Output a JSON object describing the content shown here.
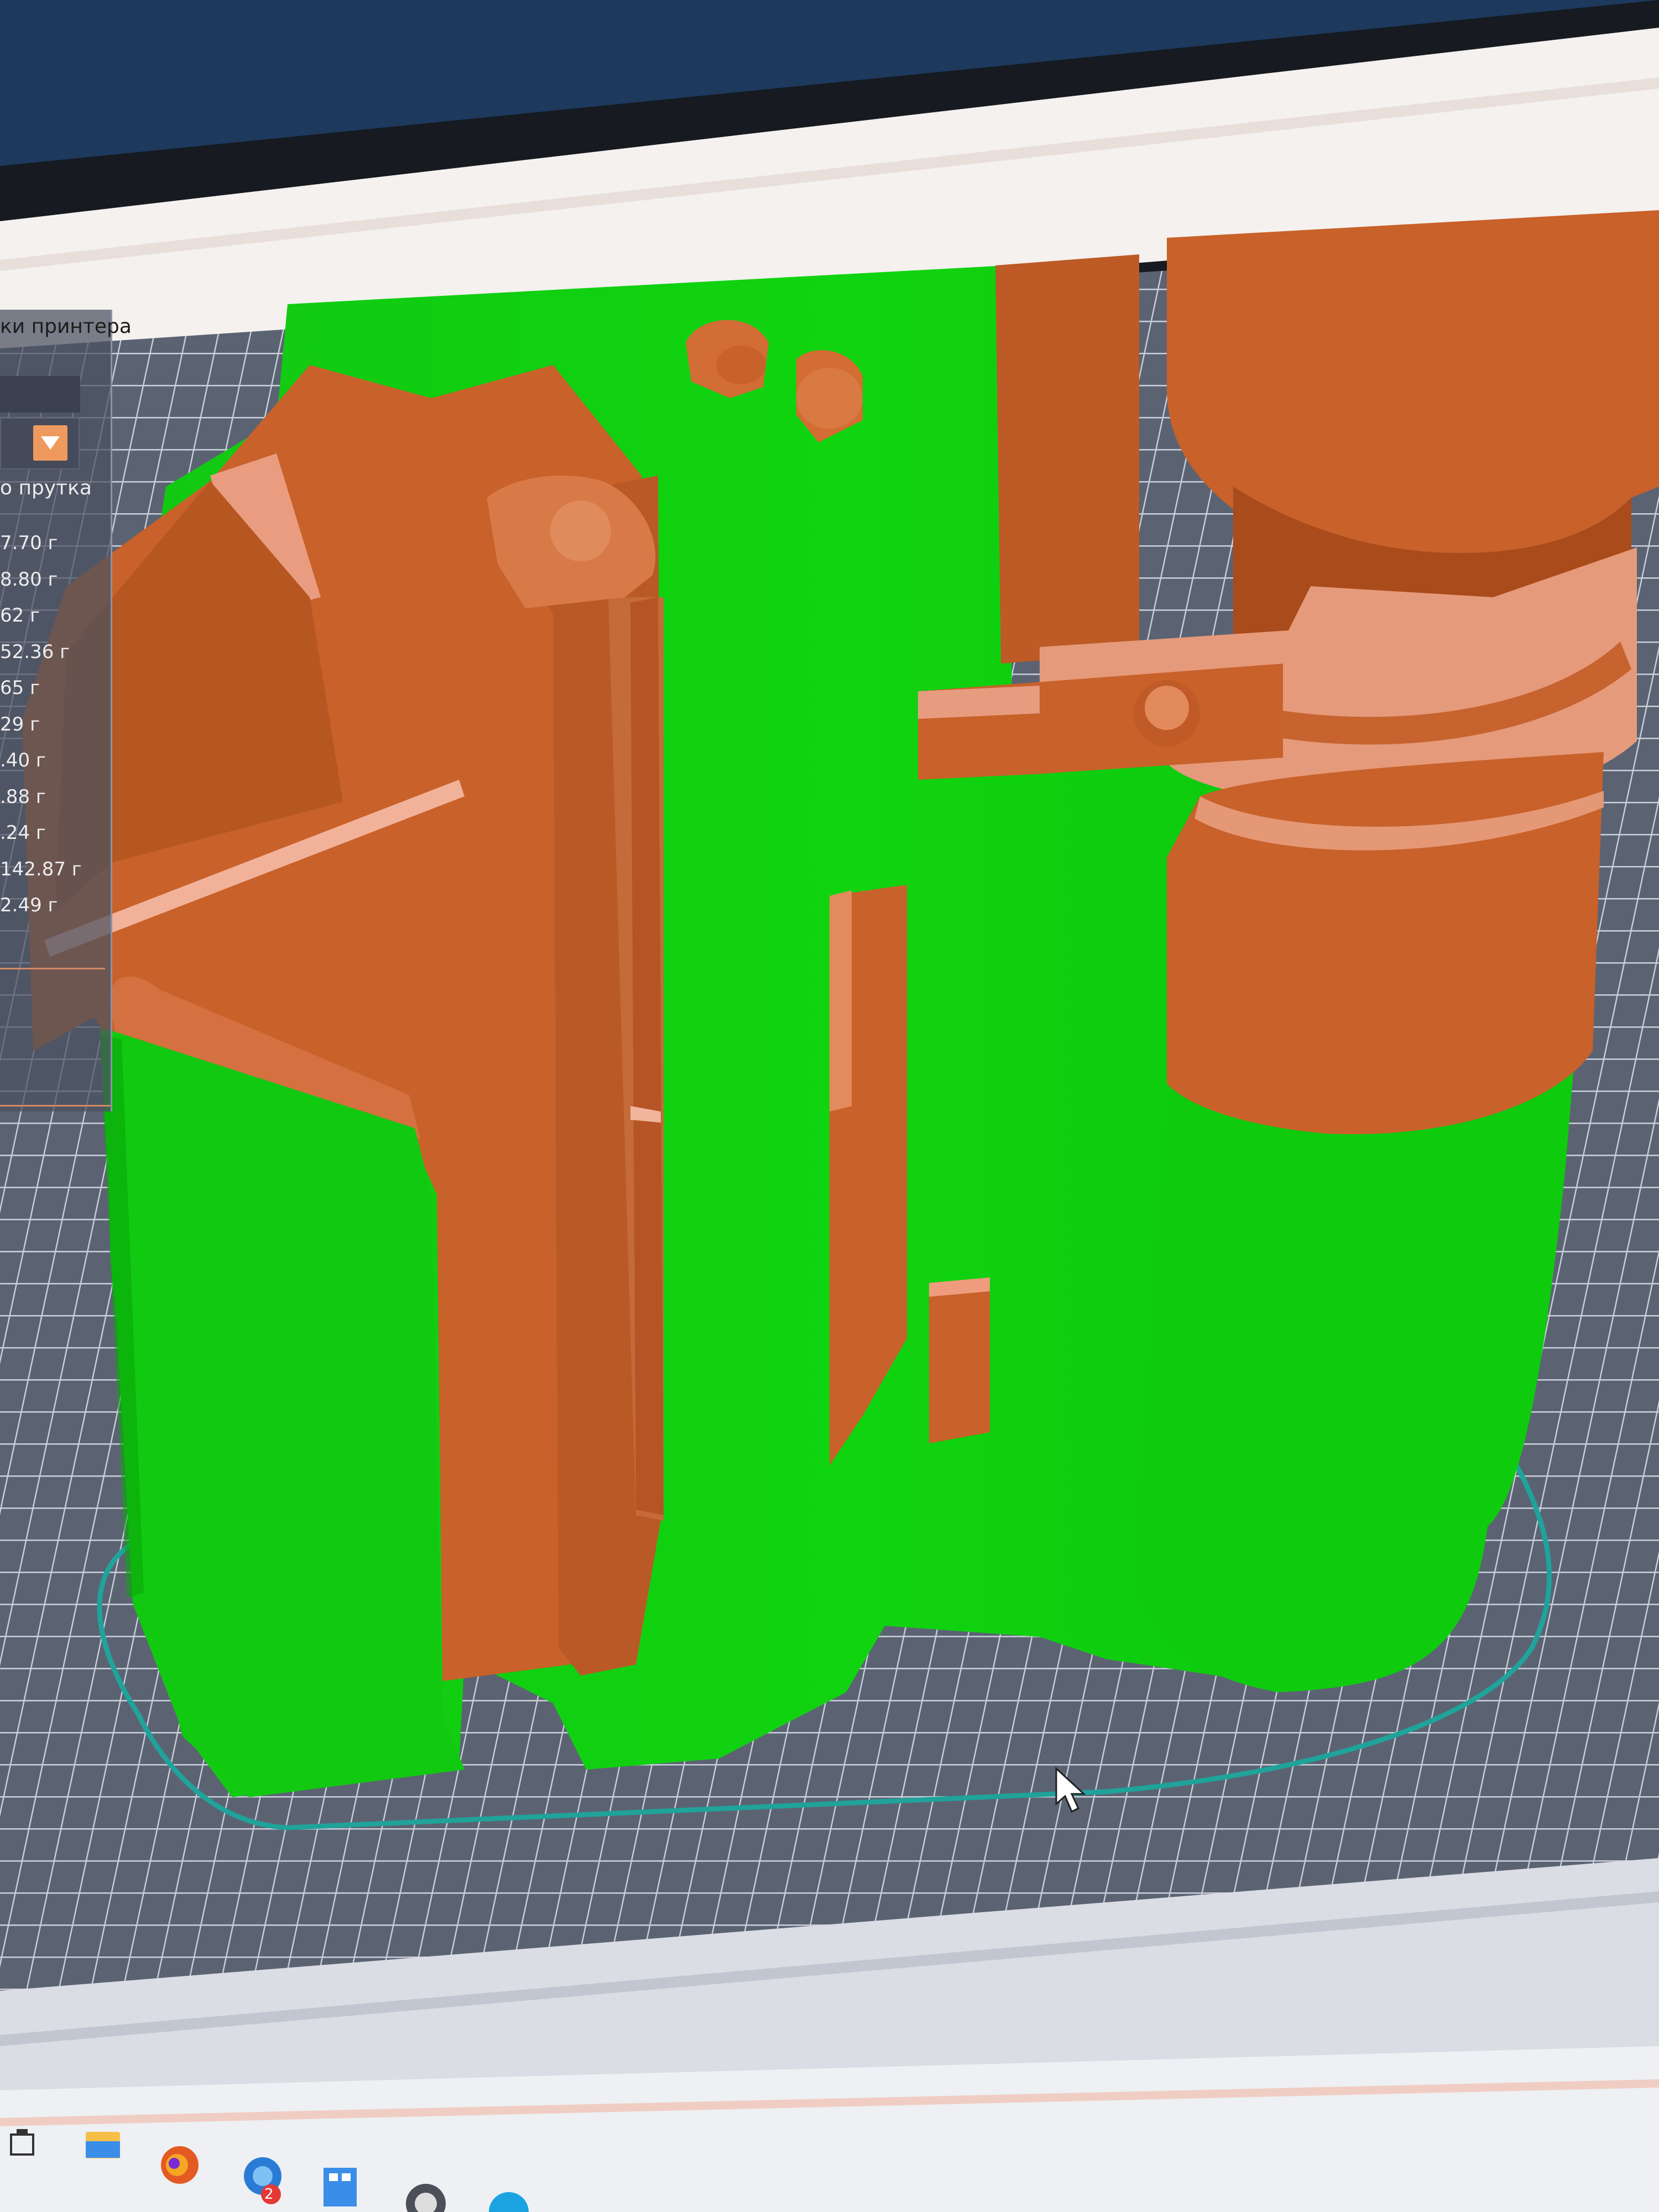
{
  "window": {
    "menu_title": "ки принтера"
  },
  "sidebar": {
    "filament_header": "о прутка",
    "weights": [
      "7.70 г",
      "8.80 г",
      "62 г",
      "52.36 г",
      "65 г",
      "29 г",
      ".40 г",
      ".88 г",
      ".24 г",
      "142.87 г",
      "2.49 г"
    ]
  },
  "colors": {
    "model_green": "#0fcf0f",
    "model_orange": "#c8612a",
    "model_orange_light": "#e99c7d",
    "build_plate": "#5e6677",
    "grid_line": "#c9ced9",
    "skirt": "#1fa39a",
    "accent": "#ee9a5e"
  },
  "taskbar": {
    "icons": [
      "task-view-icon",
      "file-explorer-icon",
      "firefox-icon",
      "messenger-icon",
      "calculator-icon",
      "obs-icon"
    ],
    "badge_count": "2"
  }
}
